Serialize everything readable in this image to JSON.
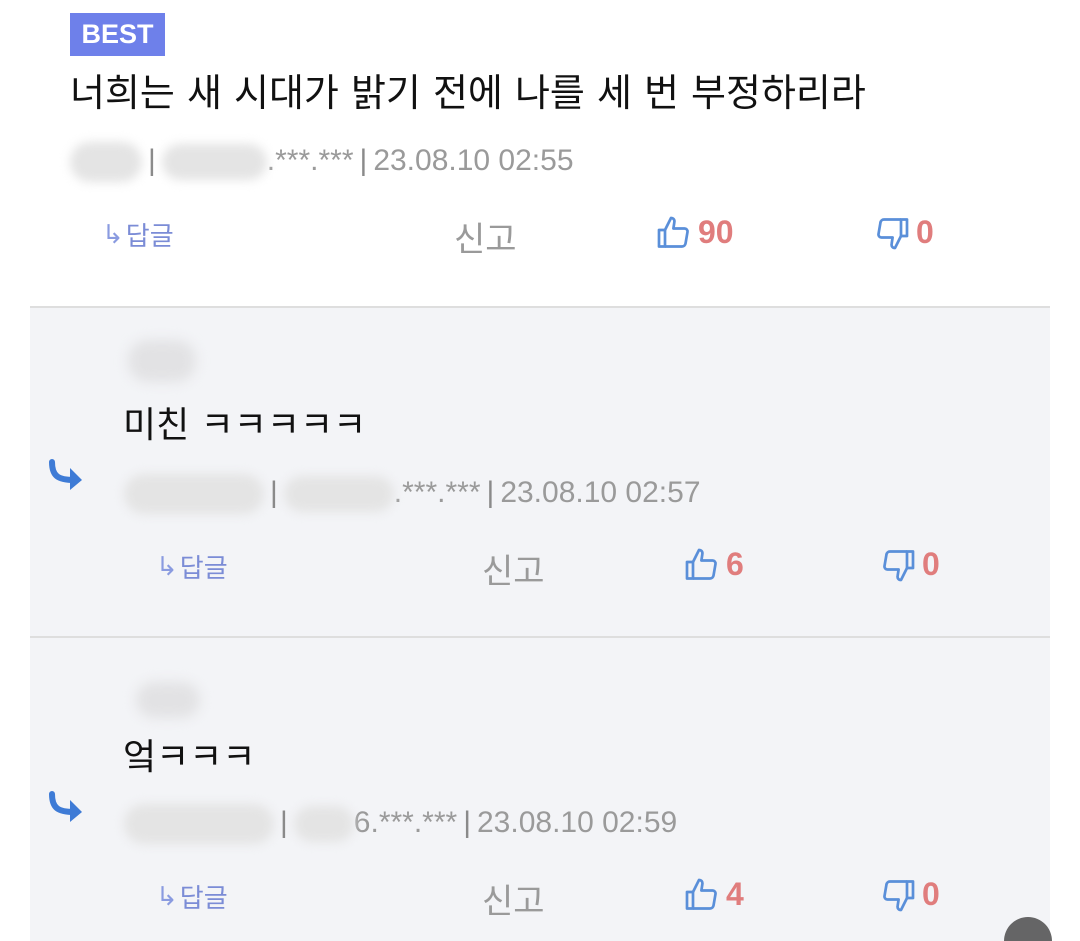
{
  "best": {
    "badge": "BEST",
    "text": "너희는 새 시대가 밝기 전에 나를 세 번 부정하리라",
    "ip_tail": ".***.***",
    "timestamp": "23.08.10 02:55",
    "reply_label": "답글",
    "report_label": "신고",
    "likes": "90",
    "dislikes": "0"
  },
  "replies": [
    {
      "text": "미친 ㅋㅋㅋㅋㅋ",
      "ip_tail": ".***.***",
      "timestamp": "23.08.10 02:57",
      "reply_label": "답글",
      "report_label": "신고",
      "likes": "6",
      "dislikes": "0"
    },
    {
      "text": "엌ㅋㅋㅋ",
      "ip_tail": "6.***.***",
      "timestamp": "23.08.10 02:59",
      "reply_label": "답글",
      "report_label": "신고",
      "likes": "4",
      "dislikes": "0"
    }
  ],
  "icons": {
    "reply_arrow": "reply-arrow-icon",
    "thumbs_up": "thumbs-up-icon",
    "thumbs_down": "thumbs-down-icon"
  },
  "colors": {
    "badge_bg": "#6e80ea",
    "count": "#e07d7d",
    "reply_bg": "#f3f4f7",
    "icon_blue": "#3e7bd6"
  }
}
